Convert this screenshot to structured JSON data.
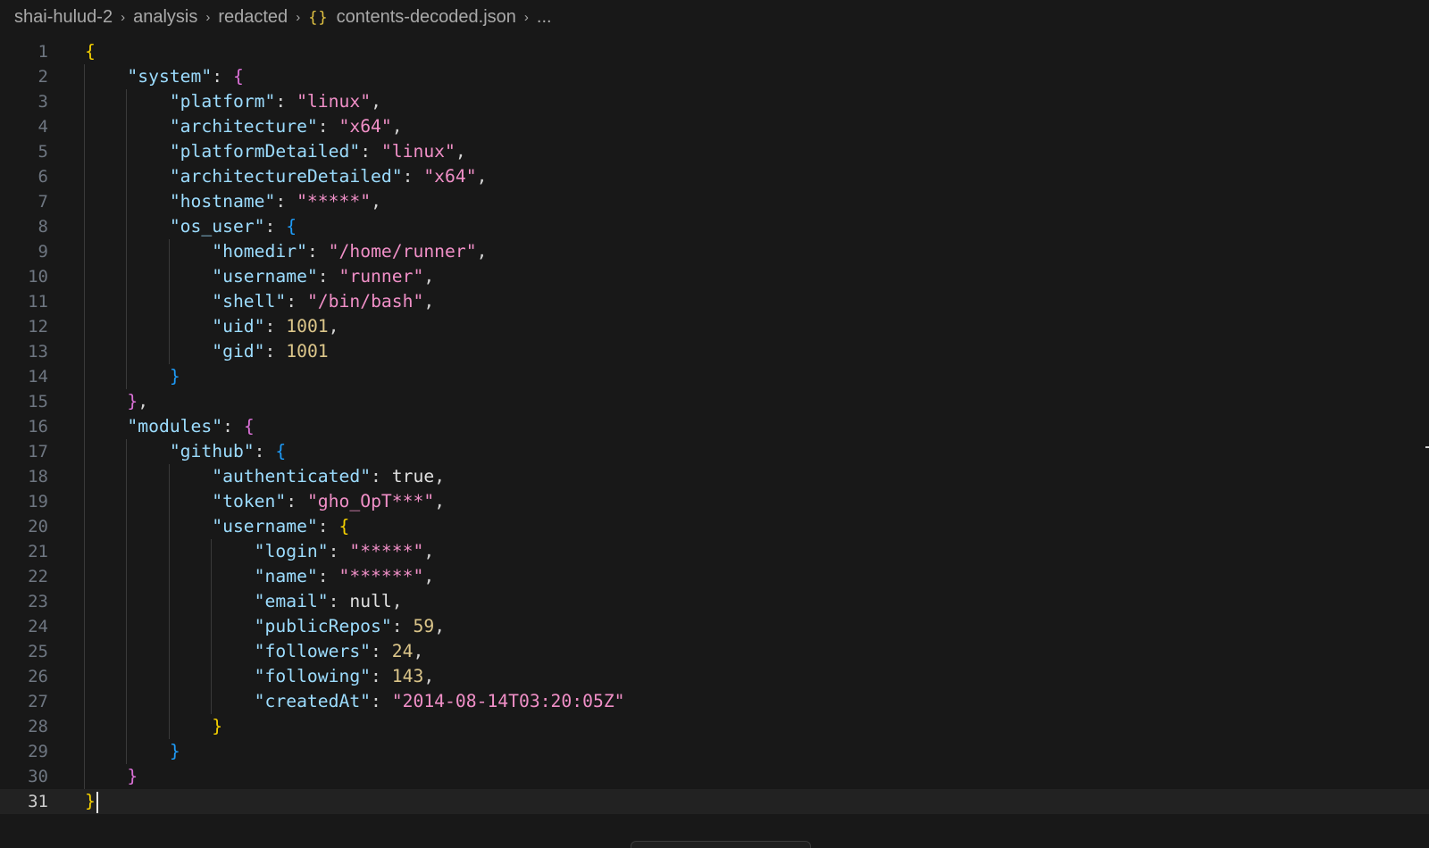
{
  "breadcrumb": {
    "items": [
      "shai-hulud-2",
      "analysis",
      "redacted"
    ],
    "file_icon": "{}",
    "file_name": "contents-decoded.json",
    "overflow": "...",
    "separator": "›"
  },
  "editor": {
    "current_line": 31,
    "lines": [
      [
        [
          "b1",
          "{"
        ]
      ],
      [
        [
          "i",
          "    "
        ],
        [
          "k",
          "\"system\""
        ],
        [
          "p",
          ": "
        ],
        [
          "b2",
          "{"
        ]
      ],
      [
        [
          "i",
          "        "
        ],
        [
          "k",
          "\"platform\""
        ],
        [
          "p",
          ": "
        ],
        [
          "sv",
          "\"linux\""
        ],
        [
          "p",
          ","
        ]
      ],
      [
        [
          "i",
          "        "
        ],
        [
          "k",
          "\"architecture\""
        ],
        [
          "p",
          ": "
        ],
        [
          "sv",
          "\"x64\""
        ],
        [
          "p",
          ","
        ]
      ],
      [
        [
          "i",
          "        "
        ],
        [
          "k",
          "\"platformDetailed\""
        ],
        [
          "p",
          ": "
        ],
        [
          "sv",
          "\"linux\""
        ],
        [
          "p",
          ","
        ]
      ],
      [
        [
          "i",
          "        "
        ],
        [
          "k",
          "\"architectureDetailed\""
        ],
        [
          "p",
          ": "
        ],
        [
          "sv",
          "\"x64\""
        ],
        [
          "p",
          ","
        ]
      ],
      [
        [
          "i",
          "        "
        ],
        [
          "k",
          "\"hostname\""
        ],
        [
          "p",
          ": "
        ],
        [
          "sv",
          "\"*****\""
        ],
        [
          "p",
          ","
        ]
      ],
      [
        [
          "i",
          "        "
        ],
        [
          "k",
          "\"os_user\""
        ],
        [
          "p",
          ": "
        ],
        [
          "b3",
          "{"
        ]
      ],
      [
        [
          "i",
          "            "
        ],
        [
          "k",
          "\"homedir\""
        ],
        [
          "p",
          ": "
        ],
        [
          "sv",
          "\"/home/runner\""
        ],
        [
          "p",
          ","
        ]
      ],
      [
        [
          "i",
          "            "
        ],
        [
          "k",
          "\"username\""
        ],
        [
          "p",
          ": "
        ],
        [
          "sv",
          "\"runner\""
        ],
        [
          "p",
          ","
        ]
      ],
      [
        [
          "i",
          "            "
        ],
        [
          "k",
          "\"shell\""
        ],
        [
          "p",
          ": "
        ],
        [
          "sv",
          "\"/bin/bash\""
        ],
        [
          "p",
          ","
        ]
      ],
      [
        [
          "i",
          "            "
        ],
        [
          "k",
          "\"uid\""
        ],
        [
          "p",
          ": "
        ],
        [
          "n",
          "1001"
        ],
        [
          "p",
          ","
        ]
      ],
      [
        [
          "i",
          "            "
        ],
        [
          "k",
          "\"gid\""
        ],
        [
          "p",
          ": "
        ],
        [
          "n",
          "1001"
        ]
      ],
      [
        [
          "i",
          "        "
        ],
        [
          "b3",
          "}"
        ]
      ],
      [
        [
          "i",
          "    "
        ],
        [
          "b2",
          "}"
        ],
        [
          "p",
          ","
        ]
      ],
      [
        [
          "i",
          "    "
        ],
        [
          "k",
          "\"modules\""
        ],
        [
          "p",
          ": "
        ],
        [
          "b2",
          "{"
        ]
      ],
      [
        [
          "i",
          "        "
        ],
        [
          "k",
          "\"github\""
        ],
        [
          "p",
          ": "
        ],
        [
          "b3",
          "{"
        ]
      ],
      [
        [
          "i",
          "            "
        ],
        [
          "k",
          "\"authenticated\""
        ],
        [
          "p",
          ": "
        ],
        [
          "kw",
          "true"
        ],
        [
          "p",
          ","
        ]
      ],
      [
        [
          "i",
          "            "
        ],
        [
          "k",
          "\"token\""
        ],
        [
          "p",
          ": "
        ],
        [
          "sv",
          "\"gho_OpT***\""
        ],
        [
          "p",
          ","
        ]
      ],
      [
        [
          "i",
          "            "
        ],
        [
          "k",
          "\"username\""
        ],
        [
          "p",
          ": "
        ],
        [
          "b1",
          "{"
        ]
      ],
      [
        [
          "i",
          "                "
        ],
        [
          "k",
          "\"login\""
        ],
        [
          "p",
          ": "
        ],
        [
          "sv",
          "\"*****\""
        ],
        [
          "p",
          ","
        ]
      ],
      [
        [
          "i",
          "                "
        ],
        [
          "k",
          "\"name\""
        ],
        [
          "p",
          ": "
        ],
        [
          "sv",
          "\"******\""
        ],
        [
          "p",
          ","
        ]
      ],
      [
        [
          "i",
          "                "
        ],
        [
          "k",
          "\"email\""
        ],
        [
          "p",
          ": "
        ],
        [
          "kw",
          "null"
        ],
        [
          "p",
          ","
        ]
      ],
      [
        [
          "i",
          "                "
        ],
        [
          "k",
          "\"publicRepos\""
        ],
        [
          "p",
          ": "
        ],
        [
          "n",
          "59"
        ],
        [
          "p",
          ","
        ]
      ],
      [
        [
          "i",
          "                "
        ],
        [
          "k",
          "\"followers\""
        ],
        [
          "p",
          ": "
        ],
        [
          "n",
          "24"
        ],
        [
          "p",
          ","
        ]
      ],
      [
        [
          "i",
          "                "
        ],
        [
          "k",
          "\"following\""
        ],
        [
          "p",
          ": "
        ],
        [
          "n",
          "143"
        ],
        [
          "p",
          ","
        ]
      ],
      [
        [
          "i",
          "                "
        ],
        [
          "k",
          "\"createdAt\""
        ],
        [
          "p",
          ": "
        ],
        [
          "sv",
          "\"2014-08-14T03:20:05Z\""
        ]
      ],
      [
        [
          "i",
          "            "
        ],
        [
          "b1",
          "}"
        ]
      ],
      [
        [
          "i",
          "        "
        ],
        [
          "b3",
          "}"
        ]
      ],
      [
        [
          "i",
          "    "
        ],
        [
          "b2",
          "}"
        ]
      ],
      [
        [
          "b1",
          "}"
        ]
      ]
    ]
  },
  "colors": {
    "background": "#181818",
    "key": "#9cdcfe",
    "string_value": "#f08fc7",
    "number": "#dcc68a",
    "bracket_level_1": "#f5d000",
    "bracket_level_2": "#da70d6",
    "bracket_level_3": "#1e9af5"
  }
}
